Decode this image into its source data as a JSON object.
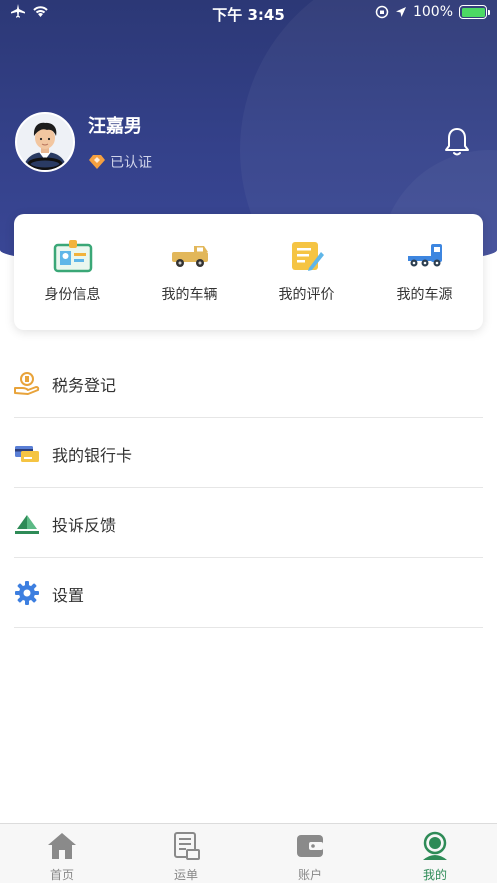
{
  "status_bar": {
    "time": "下午 3:45",
    "battery": "100%"
  },
  "profile": {
    "name": "汪嘉男",
    "verified_label": "已认证"
  },
  "quick_actions": [
    {
      "label": "身份信息",
      "icon": "id-card-icon"
    },
    {
      "label": "我的车辆",
      "icon": "truck-icon"
    },
    {
      "label": "我的评价",
      "icon": "review-note-icon"
    },
    {
      "label": "我的车源",
      "icon": "tractor-truck-icon"
    }
  ],
  "menu": [
    {
      "label": "税务登记",
      "icon": "tax-coin-hand-icon"
    },
    {
      "label": "我的银行卡",
      "icon": "bank-card-icon"
    },
    {
      "label": "投诉反馈",
      "icon": "feedback-icon"
    },
    {
      "label": "设置",
      "icon": "gear-icon"
    }
  ],
  "tabbar": [
    {
      "label": "首页",
      "icon": "home-icon",
      "active": false
    },
    {
      "label": "运单",
      "icon": "waybill-icon",
      "active": false
    },
    {
      "label": "账户",
      "icon": "wallet-icon",
      "active": false
    },
    {
      "label": "我的",
      "icon": "user-icon",
      "active": true
    }
  ],
  "colors": {
    "header": "#34418a",
    "accent": "#2e8b57",
    "verified_badge": "#f5a040"
  }
}
